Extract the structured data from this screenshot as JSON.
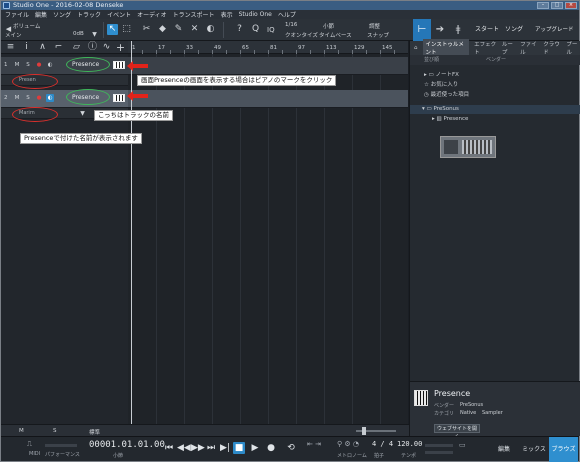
{
  "window": {
    "title": "Studio One - 2016-02-08 Denseke",
    "controls": [
      "–",
      "□",
      "×"
    ]
  },
  "menu": [
    "ファイル",
    "編集",
    "ソング",
    "トラック",
    "イベント",
    "オーディオ",
    "トランスポート",
    "表示",
    "Studio One",
    "ヘルプ"
  ],
  "toolbar": {
    "volume_label": "ボリューム",
    "volume_sub": "メイン",
    "volume_value": "0dB",
    "quantize_value": "1/16",
    "quantize_label": "クオンタイズ",
    "timebase_value": "小節",
    "timebase_label": "タイムベース",
    "snap_value": "調整",
    "snap_label": "スナップ",
    "iq_label": "IQ",
    "views": {
      "start": "スタート",
      "song": "ソング",
      "upgrade": "アップグレード"
    }
  },
  "ruler": {
    "marks": [
      "1",
      "17",
      "33",
      "49",
      "65",
      "81",
      "97",
      "113",
      "129",
      "145"
    ]
  },
  "tracks": [
    {
      "number": "1",
      "buttons": [
        "M",
        "S",
        "●",
        "◐"
      ],
      "name": "Presence",
      "sub_label": "Presen"
    },
    {
      "number": "2",
      "buttons": [
        "M",
        "S",
        "●",
        "◐"
      ],
      "name": "Presence",
      "sub_label": "Marim"
    }
  ],
  "annotations": {
    "piano_note": "画面Presenceの画面を表示する場合はピアノのマークをクリック",
    "track_name_note": "こっちはトラックの名前",
    "presence_name_note": "Presenceで付けた名前が表示されます"
  },
  "browser": {
    "tabs": [
      "インストゥルメント",
      "エフェクト",
      "ループ",
      "ファイル",
      "クラウド",
      "プール"
    ],
    "sort_label": "並び順",
    "sort_value": "ベンダー",
    "items": [
      {
        "label": "ノートFX"
      },
      {
        "label": "お気に入り"
      },
      {
        "label": "最近使った項目"
      },
      {
        "label": "PreSonus"
      },
      {
        "label": "Presence"
      }
    ],
    "info": {
      "name": "Presence",
      "vendor_label": "ベンダー",
      "vendor": "PreSonus",
      "category_label": "カテゴリ",
      "category": "Native",
      "subcategory": "Sampler",
      "website_button": "ウェブサイトを開く"
    }
  },
  "track_footer": {
    "m": "M",
    "s": "S",
    "zoom": "標準"
  },
  "transport": {
    "midi_label": "MIDI",
    "perf_label": "パフォーマンス",
    "position": "00001.01.01.00",
    "position_unit": "小節",
    "signature": "4 / 4",
    "signature_label": "拍子",
    "tempo": "120.00",
    "tempo_label": "テンポ",
    "metronome_label": "メトロノーム",
    "tabs": {
      "edit": "編集",
      "mix": "ミックス",
      "browse": "ブラウズ"
    }
  },
  "colors": {
    "accent": "#2f8fcf",
    "annotation_green": "#3fb75a",
    "annotation_red": "#d9302c"
  }
}
